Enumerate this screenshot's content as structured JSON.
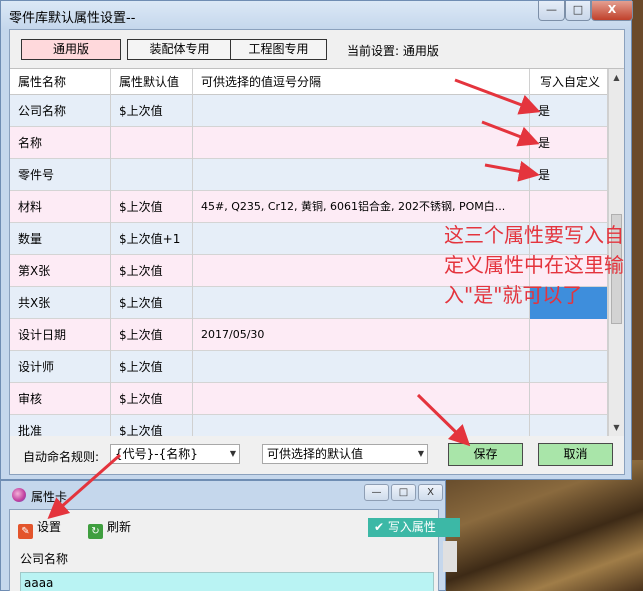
{
  "main_window": {
    "title": "零件库默认属性设置--",
    "controls": {
      "minimize": "—",
      "maximize": "□",
      "close": "X"
    }
  },
  "mode_buttons": [
    {
      "label": "通用版",
      "active": true
    },
    {
      "label": "装配体专用",
      "active": false
    },
    {
      "label": "工程图专用",
      "active": false
    }
  ],
  "current_setting": "当前设置: 通用版",
  "table": {
    "headers": [
      "属性名称",
      "属性默认值",
      "可供选择的值逗号分隔",
      "写入自定义"
    ],
    "rows": [
      {
        "name": "公司名称",
        "default": "$上次值",
        "options": "",
        "write": "是"
      },
      {
        "name": "名称",
        "default": "",
        "options": "",
        "write": "是"
      },
      {
        "name": "零件号",
        "default": "",
        "options": "",
        "write": "是"
      },
      {
        "name": "材料",
        "default": "$上次值",
        "options": "45#, Q235, Cr12, 黄铜, 6061铝合金, 202不锈钢, POM白...",
        "write": ""
      },
      {
        "name": "数量",
        "default": "$上次值+1",
        "options": "",
        "write": ""
      },
      {
        "name": "第X张",
        "default": "$上次值",
        "options": "",
        "write": ""
      },
      {
        "name": "共X张",
        "default": "$上次值",
        "options": "",
        "write": ""
      },
      {
        "name": "设计日期",
        "default": "$上次值",
        "options": "2017/05/30",
        "write": ""
      },
      {
        "name": "设计师",
        "default": "$上次值",
        "options": "",
        "write": ""
      },
      {
        "name": "审核",
        "default": "$上次值",
        "options": "",
        "write": ""
      },
      {
        "name": "批准",
        "default": "$上次值",
        "options": "",
        "write": ""
      }
    ]
  },
  "bottom": {
    "naming_rule_label": "自动命名规则:",
    "naming_rule_value": "{代号}-{名称}",
    "default_value_select": "可供选择的默认值",
    "save_label": "保存",
    "cancel_label": "取消"
  },
  "annotation": "这三个属性要写入自定义属性中在这里输入\"是\"就可以了",
  "prop_window": {
    "title": "属性卡",
    "controls": {
      "minimize": "—",
      "maximize": "□",
      "close": "X"
    },
    "toolbar": {
      "settings": "设置",
      "refresh": "刷新",
      "write_props": "写入属性"
    },
    "field_label": "公司名称",
    "field_value": "aaaa"
  },
  "colors": {
    "annotation": "#e4343d",
    "save_green": "#a9e5a9",
    "active_tab": "#ffd9dc",
    "row_blue": "#e6eef8",
    "row_pink": "#fdebf5"
  }
}
